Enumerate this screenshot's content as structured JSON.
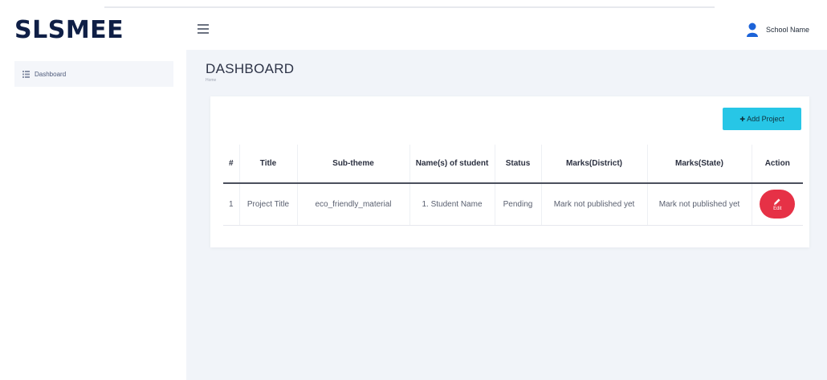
{
  "app": {
    "brand": "SLSMEE"
  },
  "header": {
    "user_name": "School Name"
  },
  "sidebar": {
    "items": [
      {
        "label": "Dashboard",
        "icon": "list-icon"
      }
    ]
  },
  "page": {
    "title": "DASHBOARD",
    "breadcrumb": "Home"
  },
  "toolbar": {
    "add_label": "Add Project",
    "add_icon": "plus-icon"
  },
  "table": {
    "headers": [
      "#",
      "Title",
      "Sub-theme",
      "Name(s) of student",
      "Status",
      "Marks(District)",
      "Marks(State)",
      "Action"
    ],
    "rows": [
      {
        "num": "1",
        "title": "Project Title",
        "sub_theme": "eco_friendly_material",
        "students": "1. Student Name",
        "status": "Pending",
        "marks_district": "Mark not published yet",
        "marks_state": "Mark not published yet",
        "action_label": "Edit"
      }
    ]
  },
  "colors": {
    "brand": "#0f1f46",
    "accent_button": "#27c6e6",
    "danger": "#e63146",
    "status_pending": "#e05663"
  }
}
